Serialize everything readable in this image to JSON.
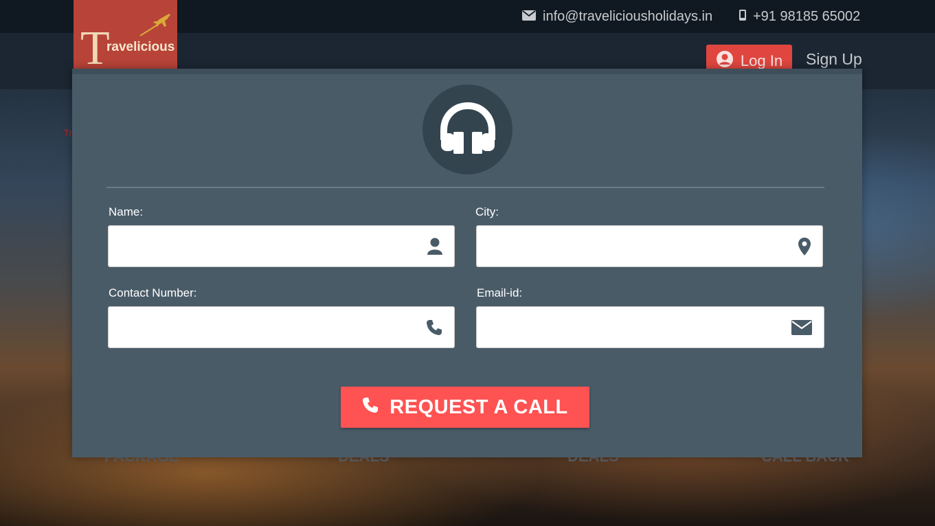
{
  "header": {
    "email": "info@traveliciousholidays.in",
    "phone": "+91 98185 65002",
    "login_label": "Log In",
    "signup_label": "Sign Up",
    "logo_text": "ravelicious"
  },
  "background": {
    "partial_red_text": "Tr",
    "labels": [
      "PACKAGE",
      "DEALS",
      "DEALS",
      "CALL BACK"
    ]
  },
  "modal": {
    "fields": {
      "name": {
        "label": "Name:",
        "value": ""
      },
      "city": {
        "label": "City:",
        "value": ""
      },
      "contact": {
        "label": "Contact Number:",
        "value": ""
      },
      "email": {
        "label": "Email-id:",
        "value": ""
      }
    },
    "submit_label": "REQUEST A CALL"
  },
  "colors": {
    "modal_bg": "#4a5b68",
    "accent": "#ff5252",
    "login_bg": "#e0463f",
    "logo_bg": "#b84338"
  }
}
